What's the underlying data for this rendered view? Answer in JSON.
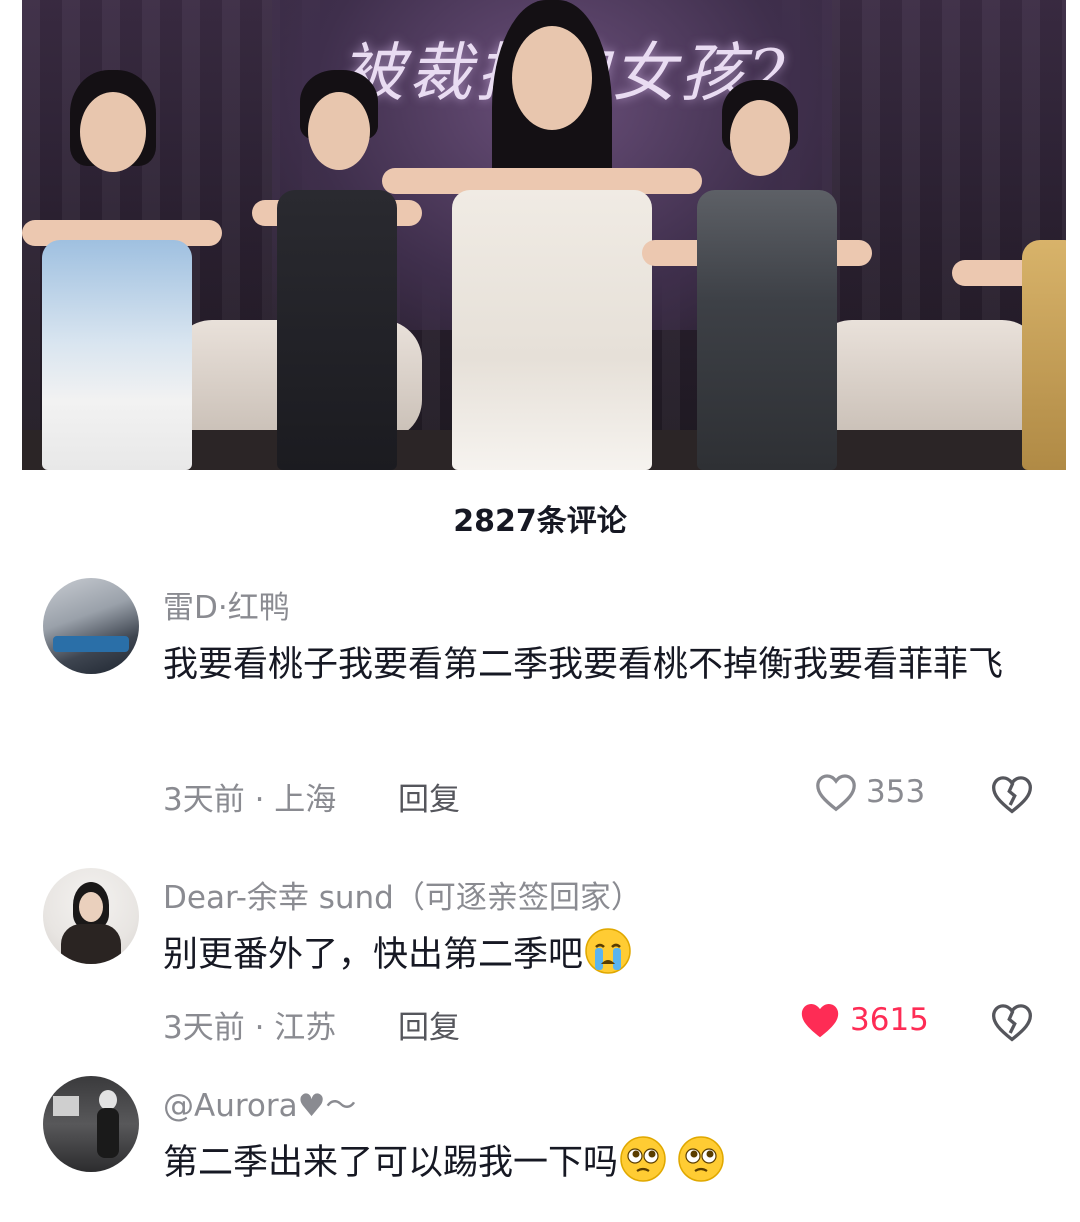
{
  "video": {
    "show_title": "被裁掉的女孩2"
  },
  "comment_count": "2827条评论",
  "comments": [
    {
      "username": "雷D·红鸭",
      "text": "我要看桃子我要看第二季我要看桃不掉衡我要看菲菲飞",
      "time_location": "3天前 · 上海",
      "reply_label": "回复",
      "likes": "353",
      "liked": false,
      "emojis": []
    },
    {
      "username": "Dear-余幸 sund（可逐亲签回家）",
      "text": "别更番外了，快出第二季吧",
      "time_location": "3天前 · 江苏",
      "reply_label": "回复",
      "likes": "3615",
      "liked": true,
      "emojis": [
        "crying-face"
      ]
    },
    {
      "username": "@Aurora♥～",
      "text": "第二季出来了可以踢我一下吗",
      "emojis": [
        "pleading-face",
        "pleading-face"
      ]
    }
  ],
  "colors": {
    "liked": "#fe2c55",
    "muted": "#8a8b91",
    "text": "#161823"
  }
}
